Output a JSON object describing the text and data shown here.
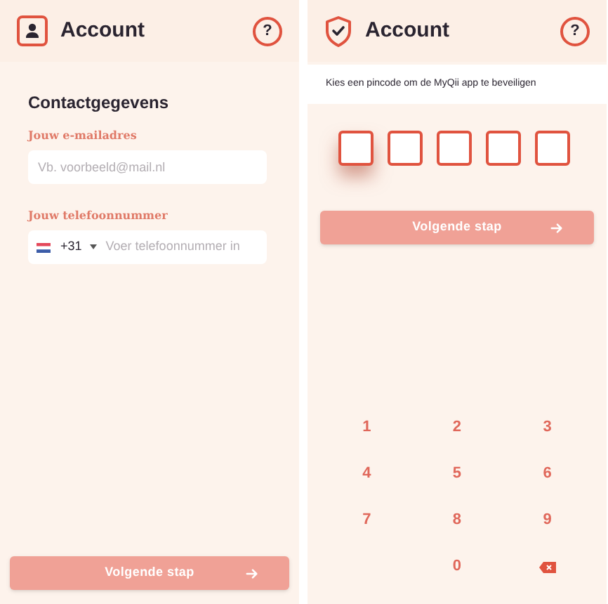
{
  "screens": [
    {
      "kind": "contact",
      "header": {
        "title": "Account",
        "help": "?"
      },
      "section_title": "Contactgegevens",
      "email": {
        "label": "Jouw e-mailadres",
        "placeholder": "Vb. voorbeeld@mail.nl"
      },
      "phone": {
        "label": "Jouw telefoonnummer",
        "country_code": "+31",
        "placeholder": "Voer telefoonnummer in"
      },
      "next_button": {
        "label": "Volgende stap",
        "disabled": true
      }
    },
    {
      "kind": "pin",
      "header": {
        "title": "Account",
        "help": "?"
      },
      "instruction": "Kies een pincode om de MyQii app te beveiligen",
      "pin_boxes": [
        {
          "focused": true
        },
        {
          "focused": false
        },
        {
          "focused": false
        },
        {
          "focused": false
        },
        {
          "focused": false
        }
      ],
      "next_button": {
        "label": "Volgende stap",
        "disabled": true
      },
      "keypad": [
        {
          "kind": "digit",
          "label": "1"
        },
        {
          "kind": "digit",
          "label": "2"
        },
        {
          "kind": "digit",
          "label": "3"
        },
        {
          "kind": "digit",
          "label": "4"
        },
        {
          "kind": "digit",
          "label": "5"
        },
        {
          "kind": "digit",
          "label": "6"
        },
        {
          "kind": "digit",
          "label": "7"
        },
        {
          "kind": "digit",
          "label": "8"
        },
        {
          "kind": "digit",
          "label": "9"
        },
        {
          "kind": "empty"
        },
        {
          "kind": "digit",
          "label": "0"
        },
        {
          "kind": "backspace"
        }
      ]
    }
  ]
}
